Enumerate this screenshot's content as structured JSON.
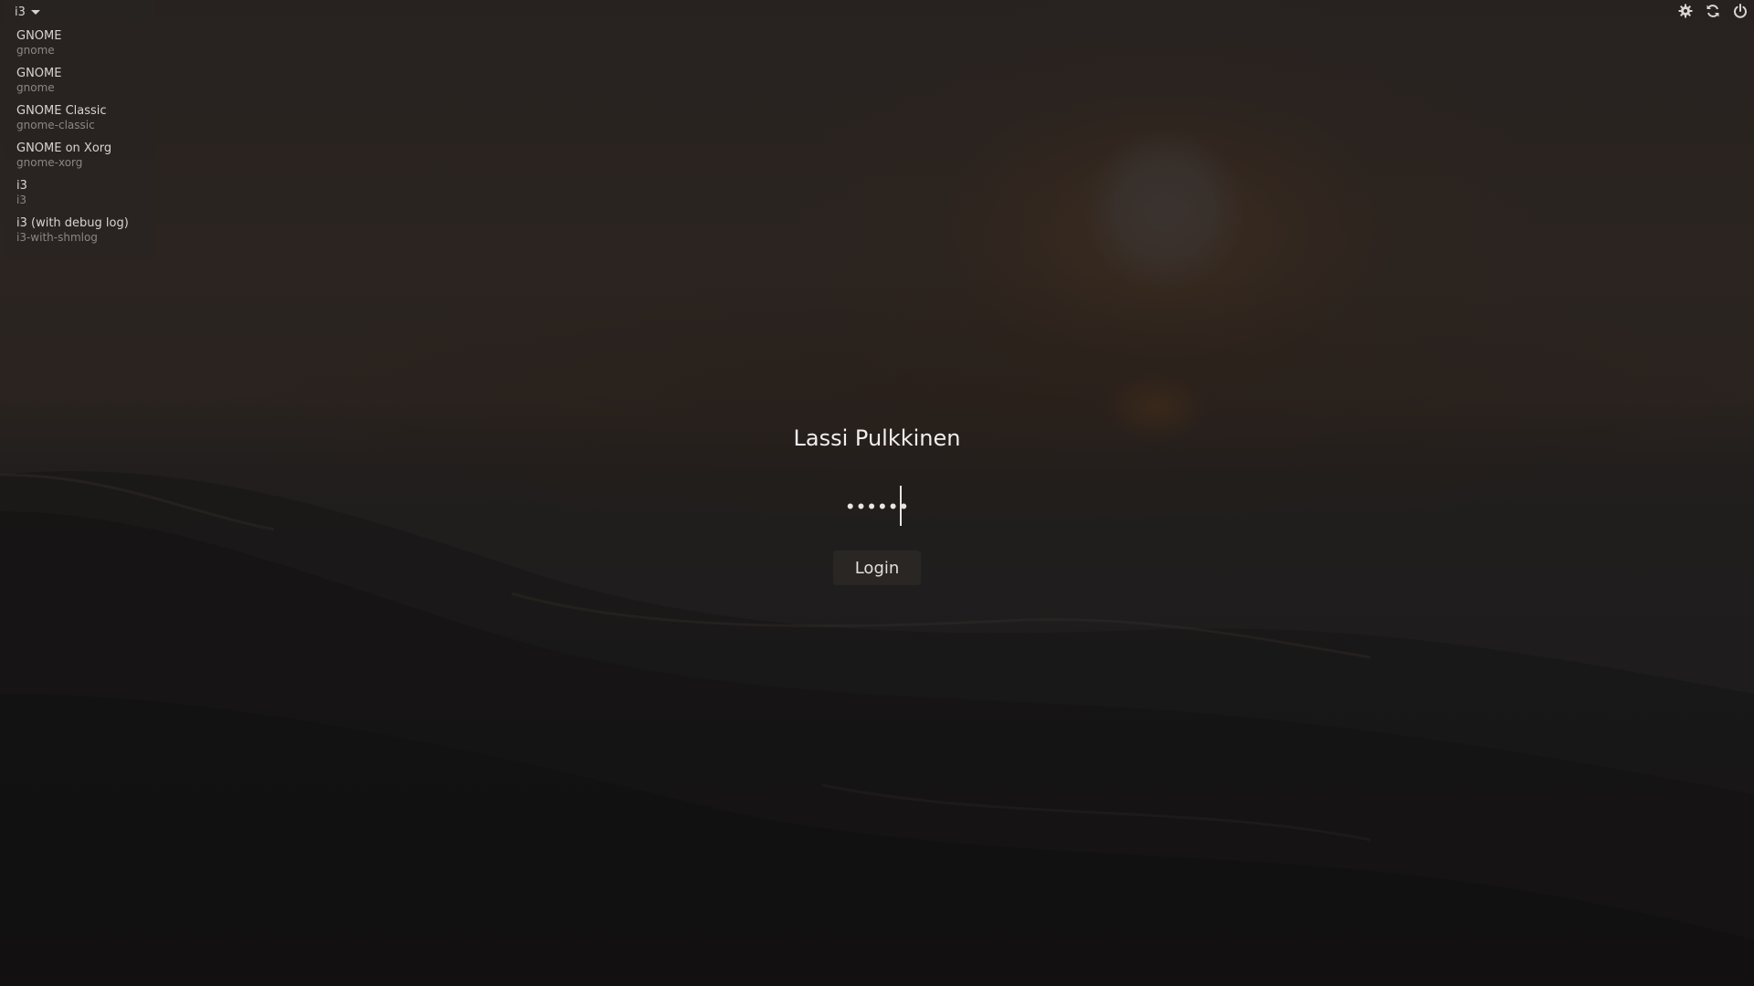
{
  "session_selector": {
    "current": "i3",
    "sessions": [
      {
        "name": "GNOME",
        "key": "gnome"
      },
      {
        "name": "GNOME",
        "key": "gnome"
      },
      {
        "name": "GNOME Classic",
        "key": "gnome-classic"
      },
      {
        "name": "GNOME on Xorg",
        "key": "gnome-xorg"
      },
      {
        "name": "i3",
        "key": "i3"
      },
      {
        "name": "i3 (with debug log)",
        "key": "i3-with-shmlog"
      }
    ]
  },
  "toolbar": {
    "icons": [
      "gear-icon",
      "refresh-icon",
      "power-icon"
    ]
  },
  "login": {
    "username": "Lassi Pulkkinen",
    "password_mask": "••••••",
    "button_label": "Login"
  },
  "colors": {
    "background": "#231f1c",
    "text": "#f0eeec",
    "muted_text": "#8b8683"
  }
}
